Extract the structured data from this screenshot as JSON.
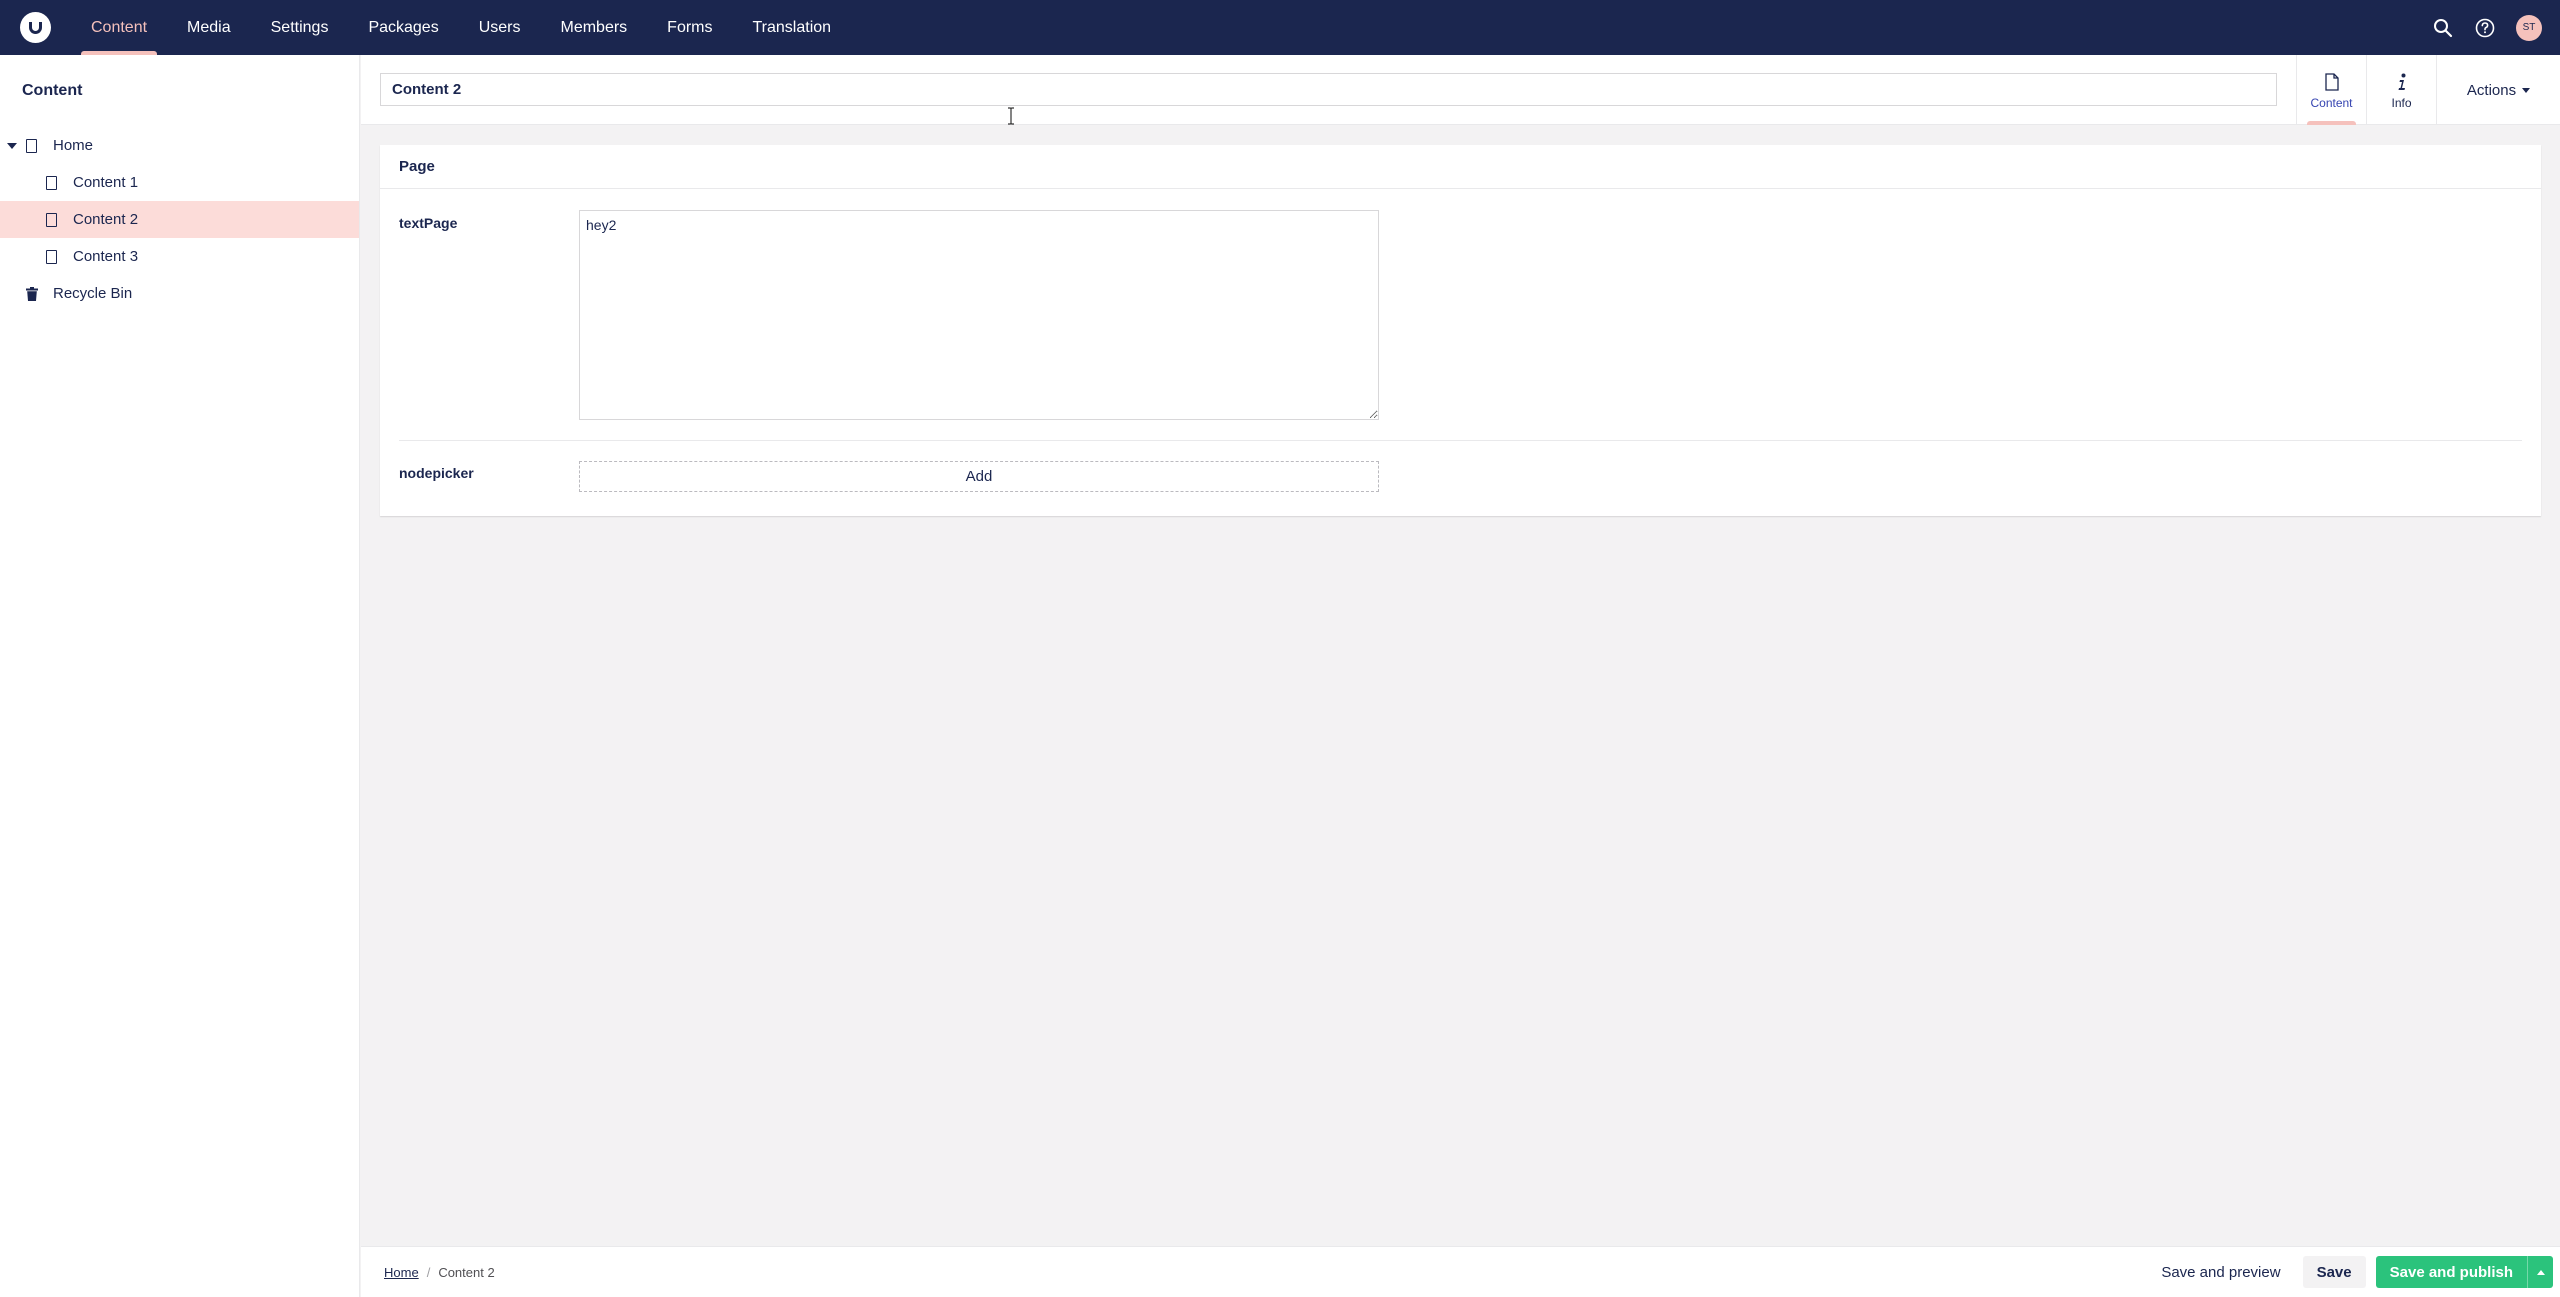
{
  "topbar": {
    "logo_icon": "umbraco-logo-icon",
    "nav": [
      {
        "label": "Content",
        "active": true
      },
      {
        "label": "Media",
        "active": false
      },
      {
        "label": "Settings",
        "active": false
      },
      {
        "label": "Packages",
        "active": false
      },
      {
        "label": "Users",
        "active": false
      },
      {
        "label": "Members",
        "active": false
      },
      {
        "label": "Forms",
        "active": false
      },
      {
        "label": "Translation",
        "active": false
      }
    ],
    "icons": [
      "search-icon",
      "help-icon"
    ],
    "avatar_initials": "ST"
  },
  "sidebar": {
    "title": "Content",
    "tree": {
      "root": {
        "label": "Home",
        "expanded": true
      },
      "children": [
        {
          "label": "Content 1",
          "selected": false
        },
        {
          "label": "Content 2",
          "selected": true
        },
        {
          "label": "Content 3",
          "selected": false
        }
      ],
      "recycle_bin": "Recycle Bin"
    }
  },
  "editor": {
    "name_value": "Content 2",
    "app_tabs": [
      {
        "label": "Content",
        "icon": "document-icon",
        "active": true
      },
      {
        "label": "Info",
        "icon": "info-icon",
        "active": false
      }
    ],
    "actions_label": "Actions",
    "group_title": "Page",
    "properties": [
      {
        "label": "textPage",
        "value": "hey2"
      },
      {
        "label": "nodepicker",
        "button_label": "Add"
      }
    ]
  },
  "footer": {
    "breadcrumb": [
      {
        "label": "Home",
        "link": true
      },
      {
        "label": "Content 2",
        "link": false
      }
    ],
    "breadcrumb_separator": "/",
    "save_and_preview": "Save and preview",
    "save": "Save",
    "save_and_publish": "Save and publish"
  },
  "colors": {
    "topbar_bg": "#1b264f",
    "accent_pink": "#f5c1bc",
    "selected_row": "#fcdcd9",
    "publish_green": "#2bc37c",
    "page_bg": "#f3f2f3"
  }
}
